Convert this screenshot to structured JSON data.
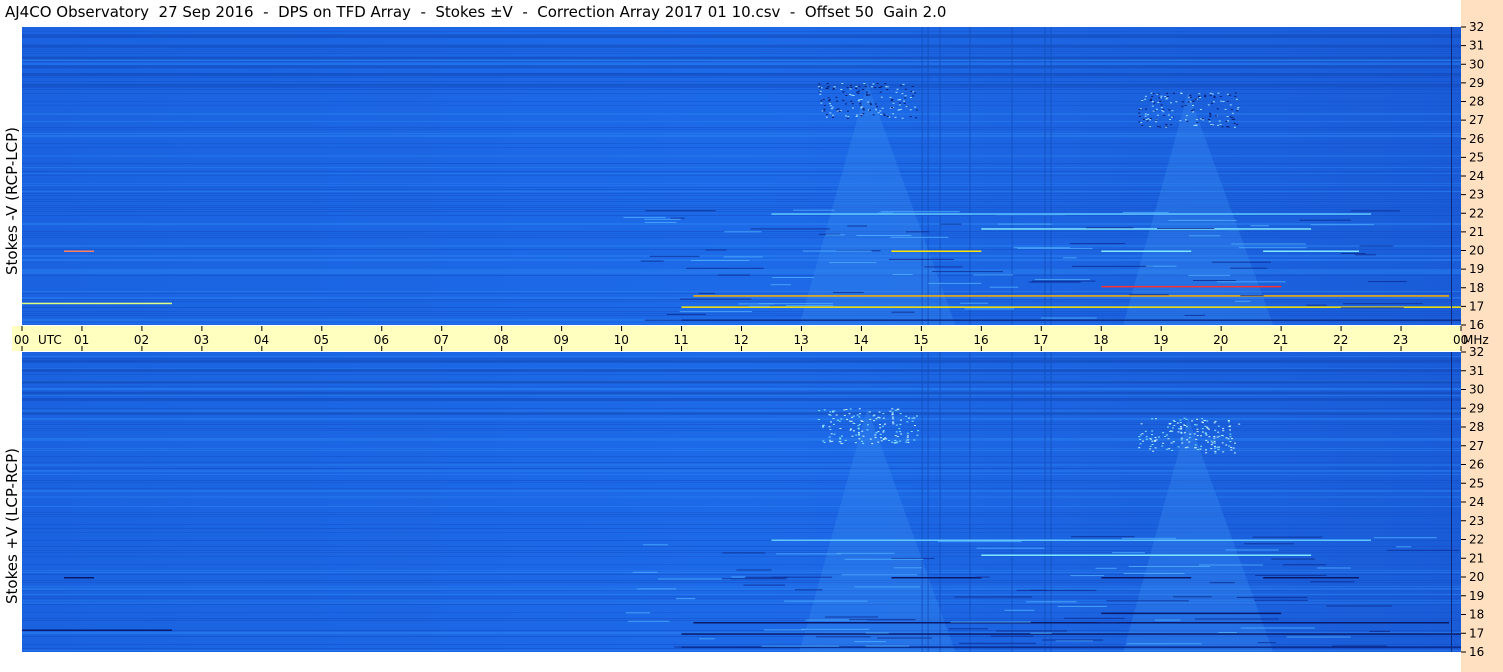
{
  "title": "AJ4CO Observatory  27 Sep 2016  -  DPS on TFD Array  -  Stokes ±V  -  Correction Array 2017 01 10.csv  -  Offset 50  Gain 2.0",
  "colors": {
    "background_blue": "#1f6fe8",
    "dark_blue": "#0a1a6a",
    "light_blue": "#4fb8ff",
    "cyan": "#7fe8ff",
    "yellow": "#ffe600",
    "red": "#ff3030",
    "axis_band": "#ffffc0",
    "right_strip": "#ffe0c0"
  },
  "chart_data": [
    {
      "type": "heatmap",
      "name": "upper",
      "ylabel": "Stokes -V (RCP-LCP)",
      "xlim": [
        0,
        24
      ],
      "ylim": [
        16,
        32
      ],
      "y_ticks": [
        16,
        17,
        18,
        19,
        20,
        21,
        22,
        23,
        24,
        25,
        26,
        27,
        28,
        29,
        30,
        31,
        32
      ],
      "features": [
        {
          "kind": "burst",
          "t": 13.3,
          "t_end": 14.9,
          "f_low": 16,
          "f_high": 29
        },
        {
          "kind": "burst",
          "t": 18.7,
          "t_end": 20.2,
          "f_low": 16,
          "f_high": 28.5
        }
      ]
    },
    {
      "type": "heatmap",
      "name": "lower",
      "ylabel": "Stokes +V (LCP-RCP)",
      "xlim": [
        0,
        24
      ],
      "ylim": [
        16,
        32
      ],
      "y_ticks": [
        16,
        17,
        18,
        19,
        20,
        21,
        22,
        23,
        24,
        25,
        26,
        27,
        28,
        29,
        30,
        31,
        32
      ],
      "features": [
        {
          "kind": "burst",
          "t": 13.3,
          "t_end": 14.9,
          "f_low": 16,
          "f_high": 29
        },
        {
          "kind": "burst",
          "t": 18.7,
          "t_end": 20.2,
          "f_low": 16,
          "f_high": 28.5
        }
      ]
    }
  ],
  "x_axis": {
    "ticks": [
      "00",
      "01",
      "02",
      "03",
      "04",
      "05",
      "06",
      "07",
      "08",
      "09",
      "10",
      "11",
      "12",
      "13",
      "14",
      "15",
      "16",
      "17",
      "18",
      "19",
      "20",
      "21",
      "22",
      "23",
      "00"
    ],
    "utc_label": "UTC",
    "mhz_label": "MHz"
  }
}
